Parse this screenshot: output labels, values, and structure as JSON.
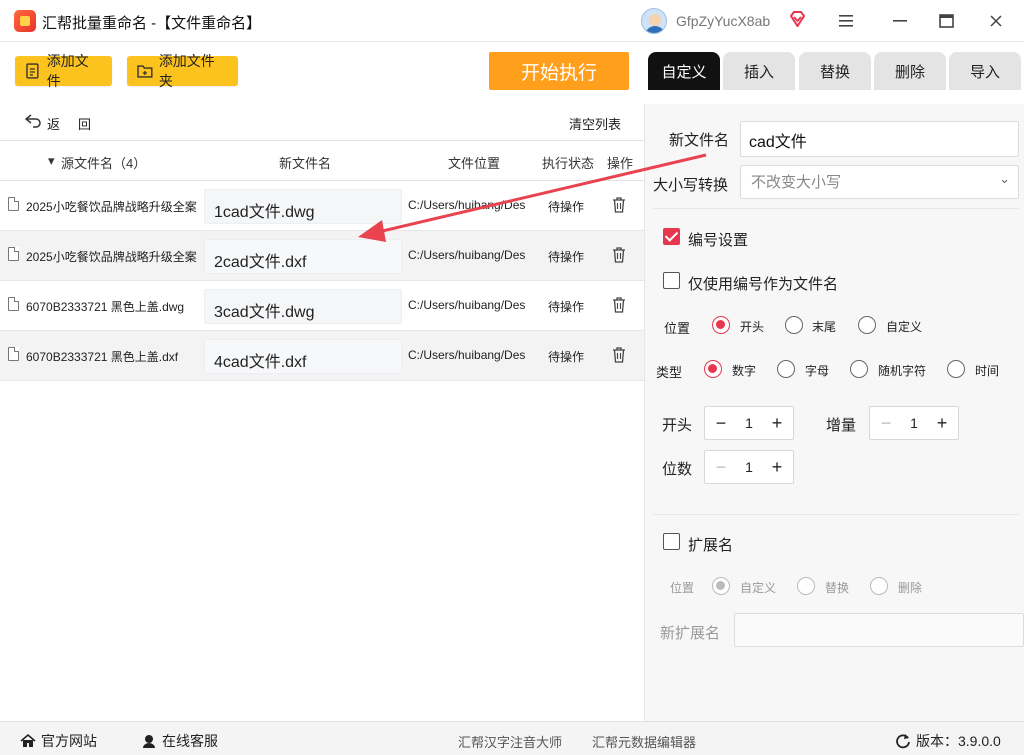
{
  "window": {
    "title": "汇帮批量重命名 -【文件重命名】",
    "username": "GfpZyYucX8ab",
    "icons": {
      "logo": "app-logo-icon",
      "avatar": "avatar",
      "vip": "vip-diamond-icon",
      "menu": "hamburger-menu-icon",
      "maximize": "maximize-icon",
      "close": "close-icon"
    }
  },
  "toolbar": {
    "add_file": "添加文件",
    "add_folder": "添加文件夹",
    "start": "开始执行"
  },
  "tabs": [
    {
      "label": "自定义",
      "active": true
    },
    {
      "label": "插入",
      "active": false
    },
    {
      "label": "替换",
      "active": false
    },
    {
      "label": "删除",
      "active": false
    },
    {
      "label": "导入",
      "active": false
    }
  ],
  "list": {
    "back": "返回",
    "clear": "清空列表",
    "columns": {
      "source": "源文件名（4）",
      "new_name": "新文件名",
      "location": "文件位置",
      "status": "执行状态",
      "action": "操作"
    },
    "rows": [
      {
        "source": "2025小吃餐饮品牌战略升级全案",
        "new_name": "1cad文件.dwg",
        "location": "C:/Users/huibang/Des",
        "status": "待操作"
      },
      {
        "source": "2025小吃餐饮品牌战略升级全案",
        "new_name": "2cad文件.dxf",
        "location": "C:/Users/huibang/Des",
        "status": "待操作"
      },
      {
        "source": "6070B2333721 黑色上盖.dwg",
        "new_name": "3cad文件.dwg",
        "location": "C:/Users/huibang/Des",
        "status": "待操作"
      },
      {
        "source": "6070B2333721 黑色上盖.dxf",
        "new_name": "4cad文件.dxf",
        "location": "C:/Users/huibang/Des",
        "status": "待操作"
      }
    ]
  },
  "settings": {
    "new_name_label": "新文件名",
    "new_name_value": "cad文件",
    "case_label": "大小写转换",
    "case_value": "不改变大小写",
    "numbering_label": "编号设置",
    "numbering_checked": true,
    "only_number_label": "仅使用编号作为文件名",
    "only_number_checked": false,
    "position_label": "位置",
    "position_options": [
      "开头",
      "末尾",
      "自定义"
    ],
    "position_selected": "开头",
    "type_label": "类型",
    "type_options": [
      "数字",
      "字母",
      "随机字符",
      "时间"
    ],
    "type_selected": "数字",
    "start_label": "开头",
    "start_value": "1",
    "increment_label": "增量",
    "increment_value": "1",
    "digits_label": "位数",
    "digits_value": "1",
    "ext_label": "扩展名",
    "ext_checked": false,
    "ext_position_label": "位置",
    "ext_options": [
      "自定义",
      "替换",
      "删除"
    ],
    "ext_selected": "自定义",
    "new_ext_label": "新扩展名",
    "new_ext_value": ""
  },
  "statusbar": {
    "website": "官方网站",
    "support": "在线客服",
    "link1": "汇帮汉字注音大师",
    "link2": "汇帮元数据编辑器",
    "version": "版本：3.9.0.0"
  },
  "colors": {
    "accent": "#e8364f",
    "toolbar_button": "#fcc31e",
    "start_button": "#ff9f1c",
    "active_tab": "#111111",
    "annotation_arrow": "#e8434f"
  }
}
